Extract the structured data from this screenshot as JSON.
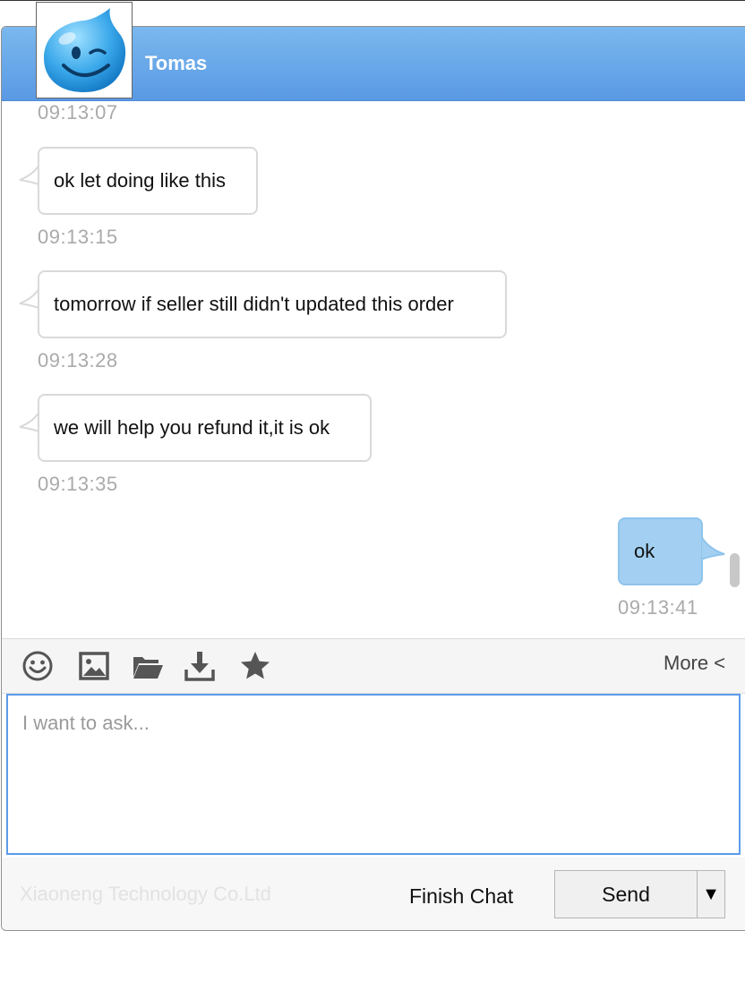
{
  "header": {
    "agent_name": "Tomas"
  },
  "messages": [
    {
      "timestamp": "09:13:07"
    },
    {
      "direction": "in",
      "text": "ok let doing like this",
      "timestamp": "09:13:15"
    },
    {
      "direction": "in",
      "text": "tomorrow if seller still didn't updated this order",
      "timestamp": "09:13:28"
    },
    {
      "direction": "in",
      "text": "we will help you refund it,it is ok",
      "timestamp": "09:13:35"
    },
    {
      "direction": "out",
      "text": "ok",
      "timestamp": "09:13:41"
    }
  ],
  "toolbar": {
    "icons": [
      "emoji-icon",
      "image-icon",
      "folder-icon",
      "download-icon",
      "star-icon"
    ],
    "more_label": "More <"
  },
  "input": {
    "placeholder": "I want to ask...",
    "value": ""
  },
  "footer": {
    "branding": "Xiaoneng Technology Co.Ltd",
    "finish_chat_label": "Finish Chat",
    "send_label": "Send",
    "send_dropdown_symbol": "▼"
  },
  "colors": {
    "header_start": "#7ab8ee",
    "header_end": "#5a99e4",
    "outgoing_bubble": "#a3d0f2",
    "input_border": "#5b9bea"
  }
}
